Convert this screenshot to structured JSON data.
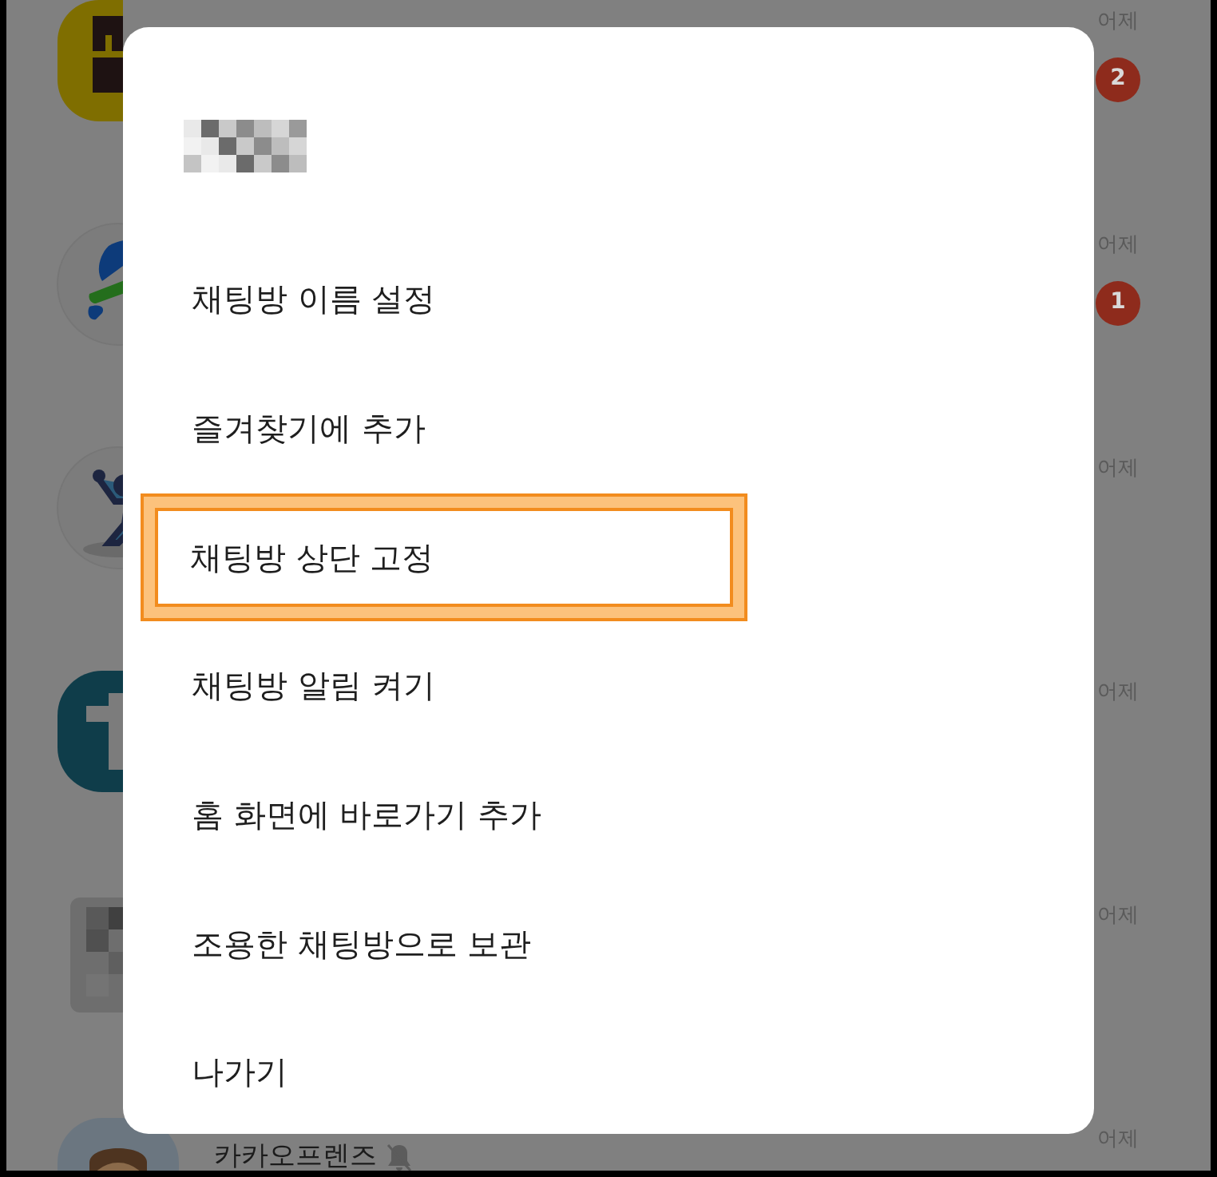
{
  "chat_list": [
    {
      "date": "어제",
      "unread": "2"
    },
    {
      "date": "어제",
      "unread": "1"
    },
    {
      "date": "어제"
    },
    {
      "date": "어제"
    },
    {
      "date": "어제"
    },
    {
      "title": "카카오프렌즈",
      "muted": true,
      "date": "어제"
    }
  ],
  "menu": {
    "items": [
      {
        "label": "채팅방 이름 설정",
        "highlighted": false
      },
      {
        "label": "즐겨찾기에 추가",
        "highlighted": false
      },
      {
        "label": "채팅방 상단 고정",
        "highlighted": true
      },
      {
        "label": "채팅방 알림 켜기",
        "highlighted": false
      },
      {
        "label": "홈 화면에 바로가기 추가",
        "highlighted": false
      },
      {
        "label": "조용한 채팅방으로 보관",
        "highlighted": false
      },
      {
        "label": "나가기",
        "highlighted": false
      }
    ]
  }
}
